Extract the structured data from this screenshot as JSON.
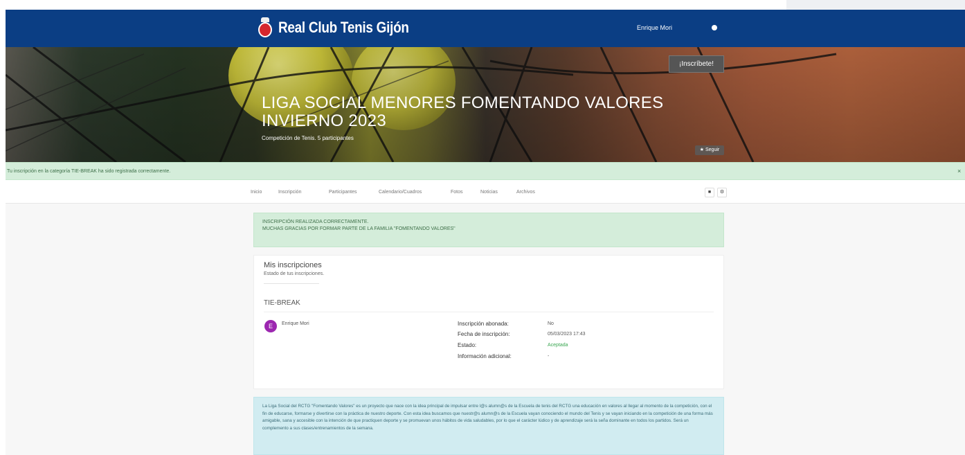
{
  "header": {
    "brand": "Real Club Tenis Gijón",
    "user_name": "Enrique Mori"
  },
  "hero": {
    "title": "LIGA SOCIAL MENORES FOMENTANDO VALORES INVIERNO 2023",
    "subtitle": "Competición de Tenis. 5 participantes",
    "inscribete_label": "¡Inscríbete!",
    "seguir_label": "★ Seguir"
  },
  "alert": {
    "message": "Tu inscripción en la categoría TIE-BREAK ha sido registrada correctamente.",
    "close": "×"
  },
  "tabs": [
    "Inicio",
    "Inscripción",
    "Participantes",
    "Calendario/Cuadros",
    "Fotos",
    "Noticias",
    "Archivos"
  ],
  "tab_icons": [
    "chat-icon",
    "settings-icon"
  ],
  "success": {
    "line1": "INSCRIPCIÓN REALIZADA CORRECTAMENTE.",
    "line2": "MUCHAS GRACIAS POR FORMAR PARTE DE LA FAMILIA \"FOMENTANDO VALORES\""
  },
  "registrations": {
    "title": "Mis inscripciones",
    "subtitle": "Estado de tus inscripciones.",
    "category": "TIE-BREAK",
    "avatar_letter": "E",
    "avatar_color": "#9c27b0",
    "participant": "Enrique Mori",
    "fields": [
      {
        "label": "Inscripción abonada:",
        "value": "No"
      },
      {
        "label": "Fecha de inscripción:",
        "value": "05/03/2023 17:43"
      },
      {
        "label": "Estado:",
        "value": "Aceptada"
      },
      {
        "label": "Información adicional:",
        "value": "-"
      }
    ]
  },
  "info": {
    "text": "La Liga Social del RCTG \"Fomentando Valores\" es un proyecto que nace con la idea principal de impulsar entre l@s alumn@s de la Escuela de tenis del RCTG una educación en valores al llegar al momento de la competición, con el fin de educarse, formarse y divertirse con la práctica de nuestro deporte. Con esta idea buscamos que nuestr@s alumn@s de la Escuela vayan conociendo el mundo del Tenis y se vayan iniciando en la competición de una forma más amigable, sana y accesible con la intención de que practiquen deporte y se promuevan unos hábitos de vida saludables, por lo que el carácter lúdico y de aprendizaje será la seña dominante en todos los partidos. Será un complemento a sus clases/entrenamientos de la semana."
  },
  "colors": {
    "header_bg": "#0b3e84",
    "success_bg": "#d4edda",
    "info_bg": "#d1ecf1",
    "accepted": "#3aa651"
  }
}
